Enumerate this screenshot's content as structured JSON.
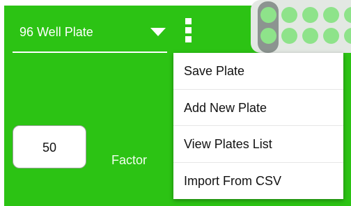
{
  "plate_selector": {
    "selected": "96 Well Plate"
  },
  "icons": {
    "dropdown": "chevron-down-icon",
    "overflow": "more-vert-icon"
  },
  "factor": {
    "value": "50",
    "label": "Factor"
  },
  "overflow_menu": {
    "items": [
      {
        "label": "Save Plate"
      },
      {
        "label": "Add New Plate"
      },
      {
        "label": "View Plates List"
      },
      {
        "label": "Import From CSV"
      }
    ]
  },
  "colors": {
    "toolbar_green": "#2cc314",
    "well_green": "#8ee38a",
    "plate_background": "#e3e8e3",
    "selected_column": "#8c9490"
  }
}
